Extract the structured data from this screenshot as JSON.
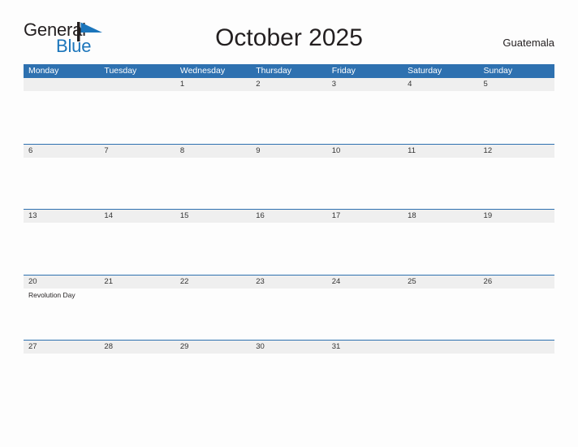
{
  "brand": {
    "name_part1": "General",
    "name_part2": "Blue",
    "logo_icon": "flag-triangle-icon",
    "accent_color": "#1b75bb",
    "dark_color": "#231f20"
  },
  "header": {
    "title": "October 2025",
    "region": "Guatemala"
  },
  "theme": {
    "header_bg": "#2e71b0",
    "band_bg": "#efefef",
    "page_bg": "#fdfdfd",
    "text_color": "#333333"
  },
  "calendar": {
    "month": "October",
    "year": "2025",
    "weekdays": [
      "Monday",
      "Tuesday",
      "Wednesday",
      "Thursday",
      "Friday",
      "Saturday",
      "Sunday"
    ],
    "weeks": [
      [
        {
          "day": "",
          "event": ""
        },
        {
          "day": "",
          "event": ""
        },
        {
          "day": "1",
          "event": ""
        },
        {
          "day": "2",
          "event": ""
        },
        {
          "day": "3",
          "event": ""
        },
        {
          "day": "4",
          "event": ""
        },
        {
          "day": "5",
          "event": ""
        }
      ],
      [
        {
          "day": "6",
          "event": ""
        },
        {
          "day": "7",
          "event": ""
        },
        {
          "day": "8",
          "event": ""
        },
        {
          "day": "9",
          "event": ""
        },
        {
          "day": "10",
          "event": ""
        },
        {
          "day": "11",
          "event": ""
        },
        {
          "day": "12",
          "event": ""
        }
      ],
      [
        {
          "day": "13",
          "event": ""
        },
        {
          "day": "14",
          "event": ""
        },
        {
          "day": "15",
          "event": ""
        },
        {
          "day": "16",
          "event": ""
        },
        {
          "day": "17",
          "event": ""
        },
        {
          "day": "18",
          "event": ""
        },
        {
          "day": "19",
          "event": ""
        }
      ],
      [
        {
          "day": "20",
          "event": "Revolution Day"
        },
        {
          "day": "21",
          "event": ""
        },
        {
          "day": "22",
          "event": ""
        },
        {
          "day": "23",
          "event": ""
        },
        {
          "day": "24",
          "event": ""
        },
        {
          "day": "25",
          "event": ""
        },
        {
          "day": "26",
          "event": ""
        }
      ],
      [
        {
          "day": "27",
          "event": ""
        },
        {
          "day": "28",
          "event": ""
        },
        {
          "day": "29",
          "event": ""
        },
        {
          "day": "30",
          "event": ""
        },
        {
          "day": "31",
          "event": ""
        },
        {
          "day": "",
          "event": ""
        },
        {
          "day": "",
          "event": ""
        }
      ]
    ]
  }
}
